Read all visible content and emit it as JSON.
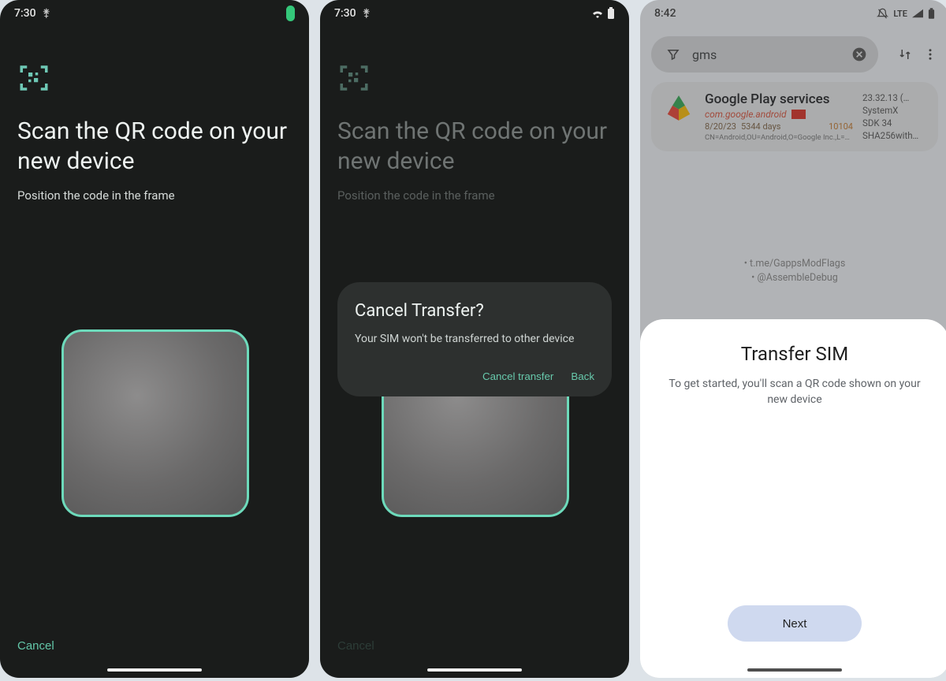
{
  "panels": [
    {
      "status": {
        "time": "7:30",
        "extras": "⚵"
      },
      "headline": "Scan the QR code on your new device",
      "subtext": "Position the code in the frame",
      "cancel": "Cancel"
    },
    {
      "status": {
        "time": "7:30",
        "extras": "⚵"
      },
      "headline": "Scan the QR code on your new device",
      "subtext": "Position the code in the frame",
      "cancel": "Cancel",
      "dialog": {
        "title": "Cancel Transfer?",
        "body": "Your SIM won't be transferred to other device",
        "primary": "Cancel transfer",
        "secondary": "Back"
      }
    },
    {
      "status": {
        "time": "8:42",
        "net": "LTE"
      },
      "search": {
        "query": "gms"
      },
      "app": {
        "name": "Google Play services",
        "pkg": "com.google.android",
        "date": "8/20/23",
        "age": "5344 days",
        "uid": "10104",
        "dn": "CN=Android,OU=Android,O=Google Inc.,L=Moun…",
        "version": "23.32.13 (…",
        "profile": "SystemX",
        "sdk": "SDK 34",
        "sha": "SHA256with…"
      },
      "credits": {
        "line1": "• t.me/GappsModFlags",
        "line2": "• @AssembleDebug"
      },
      "sheet": {
        "title": "Transfer SIM",
        "body": "To get started, you'll scan a QR code shown on your new device",
        "next": "Next"
      }
    }
  ]
}
